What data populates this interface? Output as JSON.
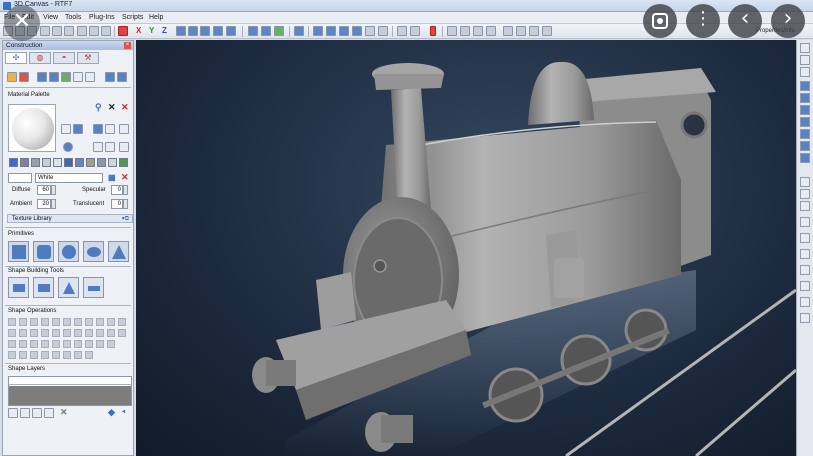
{
  "window": {
    "title": "3D Canvas - RTF7"
  },
  "menu": [
    "File",
    "Edit",
    "View",
    "Tools",
    "Plug-Ins",
    "Scripts",
    "Help"
  ],
  "toolbar": {
    "axis_x": "X",
    "axis_y": "Y",
    "axis_z": "Z",
    "properties_label": "Properties/Info"
  },
  "panel": {
    "title": "Construction",
    "close_glyph": "×",
    "tabs": [
      "✣",
      "◍",
      "◓",
      "⚒"
    ],
    "material_palette": {
      "label": "Material Palette",
      "material_name": "White",
      "diffuse_label": "Diffuse",
      "diffuse_value": "60",
      "specular_label": "Specular",
      "specular_value": "0",
      "ambient_label": "Ambient",
      "ambient_value": "20",
      "translucent_label": "Translucent",
      "translucent_value": "0"
    },
    "texture_library": {
      "label": "Texture Library"
    },
    "primitives": {
      "label": "Primitives"
    },
    "shape_building_tools": {
      "label": "Shape Building Tools"
    },
    "shape_operations": {
      "label": "Shape Operations"
    },
    "shape_layers": {
      "label": "Shape Layers"
    }
  },
  "overlay": {
    "close_glyph": "✕",
    "more_glyph": "⋮",
    "prev_glyph": "‹",
    "next_glyph": "›"
  },
  "colors": {
    "viewport_bg": "#1e2c40",
    "model_gray": "#9a9a9a",
    "accent_blue": "#4f7cc0",
    "delete_red": "#d44"
  }
}
